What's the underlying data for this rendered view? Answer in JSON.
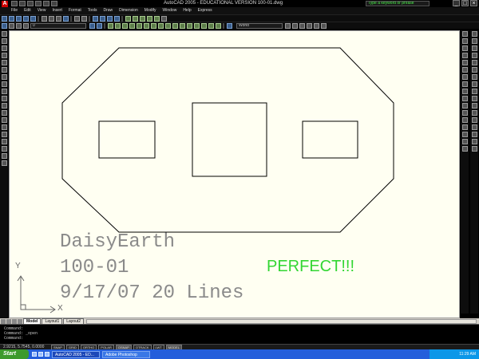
{
  "window": {
    "title": "AutoCAD 2005 - EDUCATIONAL VERSION 100-01.dwg",
    "help_placeholder": "Type a keyword or phrase",
    "app_icon": "A",
    "min_glyph": "_",
    "max_glyph": "□",
    "close_glyph": "×"
  },
  "menu": {
    "items": [
      "File",
      "Edit",
      "View",
      "Insert",
      "Format",
      "Tools",
      "Draw",
      "Dimension",
      "Modify",
      "Window",
      "Help",
      "Express"
    ]
  },
  "toolbars": {
    "layer_value": "0",
    "view_value": "World"
  },
  "drawing": {
    "title_block": {
      "line1": "DaisyEarth",
      "line2": "100-01",
      "line3": "9/17/07 20 Lines"
    },
    "stamp": "PERFECT!!!",
    "ucs_x": "X",
    "ucs_y": "Y",
    "stamp_color": "#33d633",
    "background_color": "#fffff2"
  },
  "tabs": {
    "items": [
      "Model",
      "Layout1",
      "Layout2"
    ]
  },
  "command": {
    "lines": [
      "Command:",
      "Command: _open",
      "",
      "Command:"
    ]
  },
  "status": {
    "coordinates": "2.9215, 5.7545, 0.0000",
    "modes": [
      "SNAP",
      "GRID",
      "ORTHO",
      "POLAR",
      "OSNAP",
      "OTRACK",
      "LWT",
      "MODEL"
    ]
  },
  "taskbar": {
    "start_label": "Start",
    "tasks": [
      "AutoCAD 2005 - ED...",
      "Adobe Photoshop"
    ],
    "clock": "11:29 AM"
  },
  "icons": {
    "tools_left": [
      "line-icon",
      "construction-line-icon",
      "polyline-icon",
      "polygon-icon",
      "rectangle-icon",
      "arc-icon",
      "circle-icon",
      "revcloud-icon",
      "spline-icon",
      "ellipse-icon",
      "insert-block-icon",
      "make-block-icon",
      "point-icon",
      "hatch-icon",
      "region-icon",
      "table-icon",
      "mtext-icon"
    ],
    "tools_right": [
      "erase-icon",
      "copy-icon",
      "mirror-icon",
      "offset-icon",
      "array-icon",
      "move-icon",
      "rotate-icon",
      "scale-icon",
      "stretch-icon",
      "trim-icon",
      "extend-icon",
      "break-icon",
      "join-icon",
      "chamfer-icon",
      "fillet-icon",
      "explode-icon"
    ]
  }
}
